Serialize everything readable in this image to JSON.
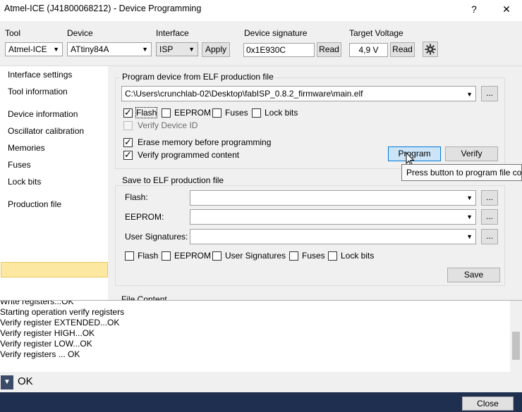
{
  "window": {
    "title": "Atmel-ICE (J41800068212) - Device Programming",
    "help_label": "?",
    "close_label": "✕"
  },
  "toolbar": {
    "tool_label": "Tool",
    "tool_value": "Atmel-ICE",
    "device_label": "Device",
    "device_value": "ATtiny84A",
    "interface_label": "Interface",
    "interface_value": "ISP",
    "apply_label": "Apply",
    "signature_label": "Device signature",
    "signature_value": "0x1E930C",
    "signature_read_label": "Read",
    "voltage_label": "Target Voltage",
    "voltage_value": "4,9 V",
    "voltage_read_label": "Read",
    "settings_icon": "gear-icon"
  },
  "sidebar": {
    "items": [
      {
        "label": "Interface settings"
      },
      {
        "label": "Tool information"
      },
      {
        "label": "Device information"
      },
      {
        "label": "Oscillator calibration"
      },
      {
        "label": "Memories"
      },
      {
        "label": "Fuses"
      },
      {
        "label": "Lock bits"
      },
      {
        "label": "Production file"
      }
    ],
    "selected": "Production file"
  },
  "program": {
    "title": "Program device from ELF production file",
    "file_path": "C:\\Users\\crunchlab-02\\Desktop\\fabISP_0.8.2_firmware\\main.elf",
    "browse_label": "...",
    "options": [
      {
        "label": "Flash",
        "checked": true
      },
      {
        "label": "EEPROM",
        "checked": false
      },
      {
        "label": "Fuses",
        "checked": false
      },
      {
        "label": "Lock bits",
        "checked": false
      }
    ],
    "verify_id_label": "Verify Device ID",
    "erase_label": "Erase memory before programming",
    "verify_content_label": "Verify programmed content",
    "program_button": "Program",
    "verify_button": "Verify",
    "tooltip": "Press button to program file co"
  },
  "save": {
    "title": "Save to ELF production file",
    "flash_label": "Flash:",
    "eeprom_label": "EEPROM:",
    "user_sig_label": "User Signatures:",
    "browse_label": "...",
    "options": [
      {
        "label": "Flash",
        "checked": false
      },
      {
        "label": "EEPROM",
        "checked": false
      },
      {
        "label": "User Signatures",
        "checked": false
      },
      {
        "label": "Fuses",
        "checked": false
      },
      {
        "label": "Lock bits",
        "checked": false
      }
    ],
    "save_button": "Save"
  },
  "file_content_title": "File Content",
  "log": {
    "lines": [
      "Write registers...OK",
      "Starting operation verify registers",
      "Verify register EXTENDED...OK",
      "Verify register HIGH...OK",
      "Verify register LOW...OK",
      "Verify registers ... OK"
    ]
  },
  "status": {
    "icon": "chevron-down-icon",
    "text": "OK"
  },
  "close_button": "Close",
  "colors": {
    "selected_bg": "#fce8a0",
    "bottom_bar": "#1f2f4f"
  }
}
